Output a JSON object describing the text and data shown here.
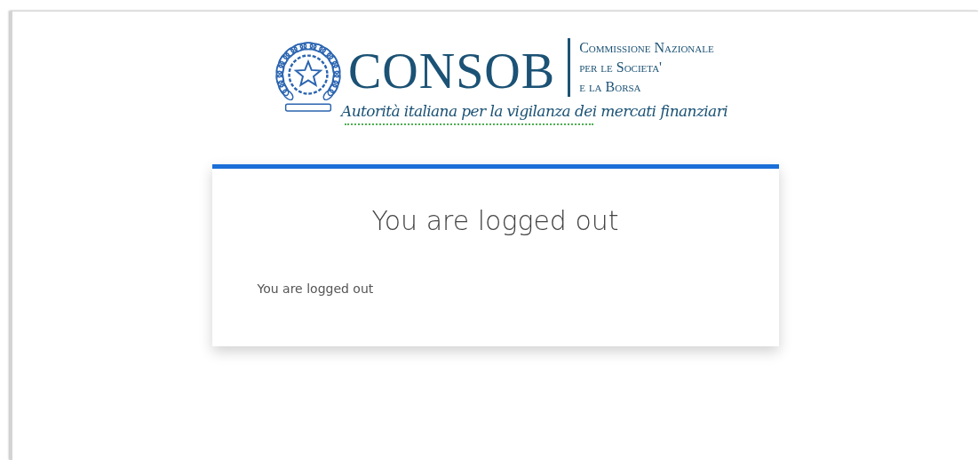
{
  "header": {
    "logo_wordmark": "CONSOB",
    "logo_subtitle_lines": [
      "Commissione Nazionale",
      "per le Societa'",
      "e la Borsa"
    ],
    "tagline": "Autorità italiana per la vigilanza dei mercati finanziari"
  },
  "card": {
    "title": "You are logged out",
    "message": "You are logged out"
  }
}
